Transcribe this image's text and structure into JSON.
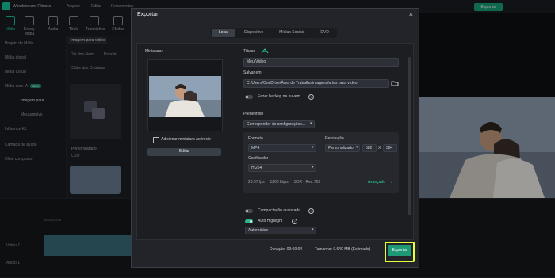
{
  "app": {
    "name": "Wondershare Filmora",
    "menu": [
      "Arquivo",
      "Editar",
      "Ferramentas",
      "Visualizar"
    ],
    "top_export": "Exportar",
    "tools": [
      "Mídia",
      "Estoq. Mídia",
      "Áudio",
      "Título",
      "Transições",
      "Efeitos"
    ],
    "sidebar": [
      "Projeto de Mídia",
      "Mídia global",
      "Mídia Cloud",
      "Mídia com IA",
      "Imagem para ...",
      "Meu arquivo",
      "Influence Kit",
      "Camada de ajuste",
      "Clipe composto"
    ],
    "ia_badge": "NEW",
    "library_chips": [
      "Imagem para vídeo",
      "Dia dos Nam.",
      "Popular",
      "Clube das Criaturas"
    ],
    "library_item": "Personalizado",
    "library_create": "Criar",
    "timeline_time": "00:00:00:00",
    "timeline_tracks": [
      "Vídeo 1",
      "Áudio 1"
    ]
  },
  "dialog": {
    "title": "Exportar",
    "close": "×",
    "tabs": [
      "Local",
      "Dispositivo",
      "Mídias Sociais",
      "DVD"
    ],
    "thumbnail_label": "Miniatura:",
    "add_thumbnail": "Adicionar miniatura ao início",
    "edit_button": "Editar",
    "title_label": "Títulos",
    "title_value": "Meu Vídeo",
    "save_label": "Salvar em",
    "save_path": "C:/Users/OneDrive/Área de Trabalho/imagens/artes para vídeo",
    "backup_label": "Fazer backup na nuvem",
    "preset_label": "Predefinido",
    "preset_value": "Corresponder às configurações...",
    "format_label": "Formato",
    "format_value": "MP4",
    "resolution_label": "Resolução",
    "resolution_value": "Personalizado",
    "res_w": "682",
    "res_x": "X",
    "res_h": "384",
    "codec_label": "Codificador",
    "codec_value": "H.264",
    "stats": "23.97 fps     1200 kbps     SDR - Rec.709",
    "advanced": "Avançado",
    "compact_label": "Compactação avançada",
    "autohl_label": "Auto Highlight",
    "autohl_value": "Automático",
    "duration": "Duração: 00:00:04",
    "size": "Tamanho: 0.640 MB (Estimado)",
    "export_button": "Exportar"
  }
}
